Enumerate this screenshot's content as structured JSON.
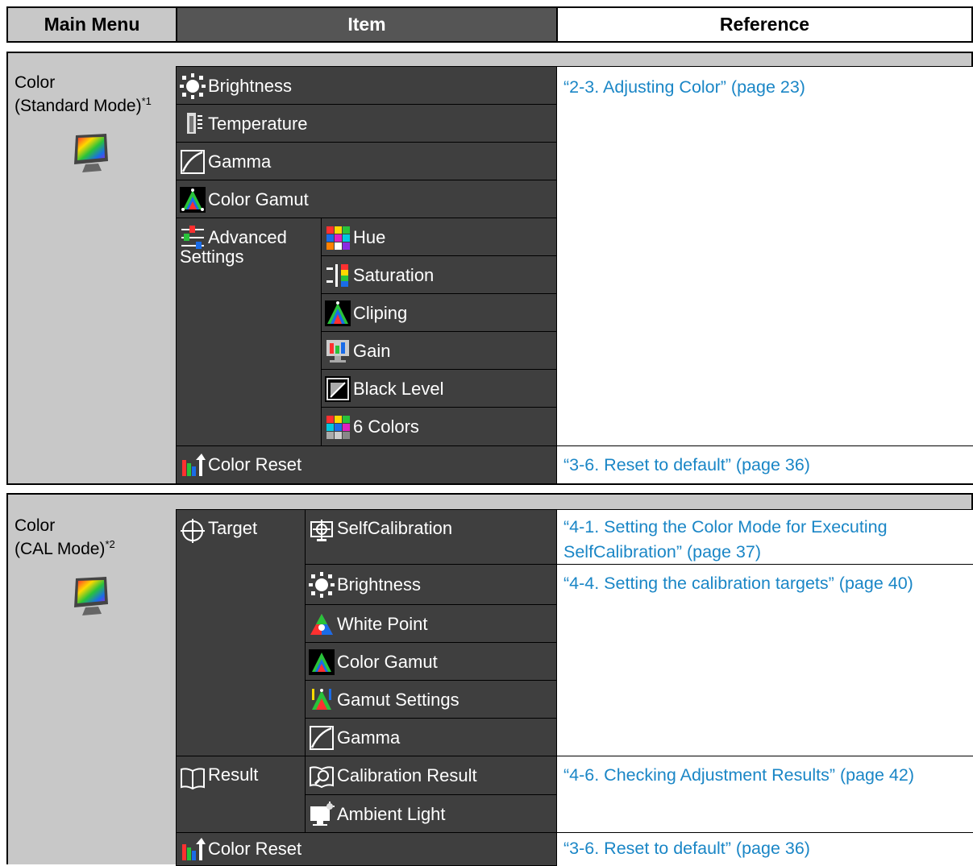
{
  "header": {
    "main_menu": "Main Menu",
    "item": "Item",
    "reference": "Reference"
  },
  "section1": {
    "menu_line1": "Color",
    "menu_line2": "(Standard Mode)",
    "menu_note": "*1",
    "items": {
      "brightness": "Brightness",
      "temperature": "Temperature",
      "gamma": "Gamma",
      "color_gamut": "Color Gamut",
      "advanced_line1": "Advanced",
      "advanced_line2": "Settings",
      "hue": "Hue",
      "saturation": "Saturation",
      "cliping": "Cliping",
      "gain": "Gain",
      "black_level": "Black Level",
      "six_colors": "6 Colors",
      "color_reset": "Color Reset"
    },
    "refs": {
      "adjusting_color": "“2-3. Adjusting Color” (page 23)",
      "reset_default": "“3-6. Reset to default” (page 36)"
    }
  },
  "section2": {
    "menu_line1": "Color",
    "menu_line2": "(CAL Mode)",
    "menu_note": "*2",
    "items": {
      "target": "Target",
      "selfcalibration": "SelfCalibration",
      "brightness": "Brightness",
      "white_point": "White Point",
      "color_gamut": "Color Gamut",
      "gamut_settings": "Gamut Settings",
      "gamma": "Gamma",
      "result": "Result",
      "calibration_result": "Calibration Result",
      "ambient_light": "Ambient Light",
      "color_reset": "Color Reset"
    },
    "refs": {
      "setting_color_mode_line1": "“4-1. Setting the Color Mode for Executing",
      "setting_color_mode_line2": "SelfCalibration” (page 37)",
      "calibration_targets": "“4-4. Setting the calibration targets” (page 40)",
      "checking_results": "“4-6. Checking Adjustment Results” (page 42)",
      "reset_default": "“3-6. Reset to default” (page 36)"
    }
  },
  "colors": {
    "header_bg": "#c8c8c8",
    "item_header_bg": "#555555",
    "cell_bg": "#3f3f3f",
    "link": "#1a86c6"
  }
}
